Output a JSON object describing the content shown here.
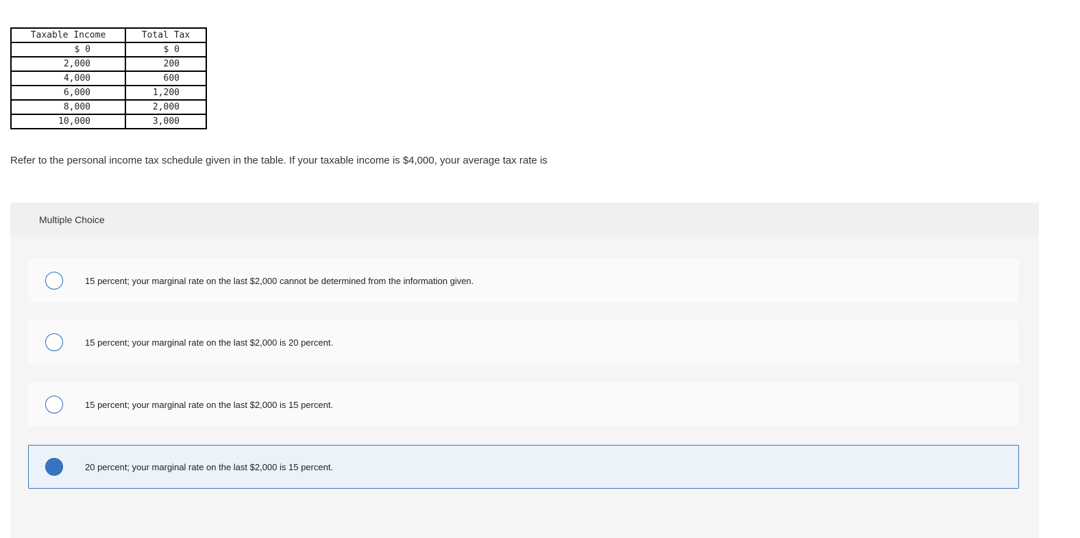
{
  "table": {
    "headers": [
      "Taxable Income",
      "Total Tax"
    ],
    "rows": [
      {
        "income": "$ 0",
        "tax": "$ 0"
      },
      {
        "income": "2,000",
        "tax": "200"
      },
      {
        "income": "4,000",
        "tax": "600"
      },
      {
        "income": "6,000",
        "tax": "1,200"
      },
      {
        "income": "8,000",
        "tax": "2,000"
      },
      {
        "income": "10,000",
        "tax": "3,000"
      }
    ]
  },
  "question": "Refer to the personal income tax schedule given in the table. If your taxable income is $4,000, your average tax rate is",
  "multiple_choice": {
    "label": "Multiple Choice",
    "options": [
      {
        "text": "15 percent; your marginal rate on the last $2,000 cannot be determined from the information given.",
        "selected": false
      },
      {
        "text": "15 percent; your marginal rate on the last $2,000 is 20 percent.",
        "selected": false
      },
      {
        "text": "15 percent; your marginal rate on the last $2,000 is 15 percent.",
        "selected": false
      },
      {
        "text": "20 percent; your marginal rate on the last $2,000 is 15 percent.",
        "selected": true
      }
    ]
  },
  "colors": {
    "accent": "#3a74c0",
    "selected_background": "#ebf2fa",
    "panel_background": "#f5f5f5"
  }
}
